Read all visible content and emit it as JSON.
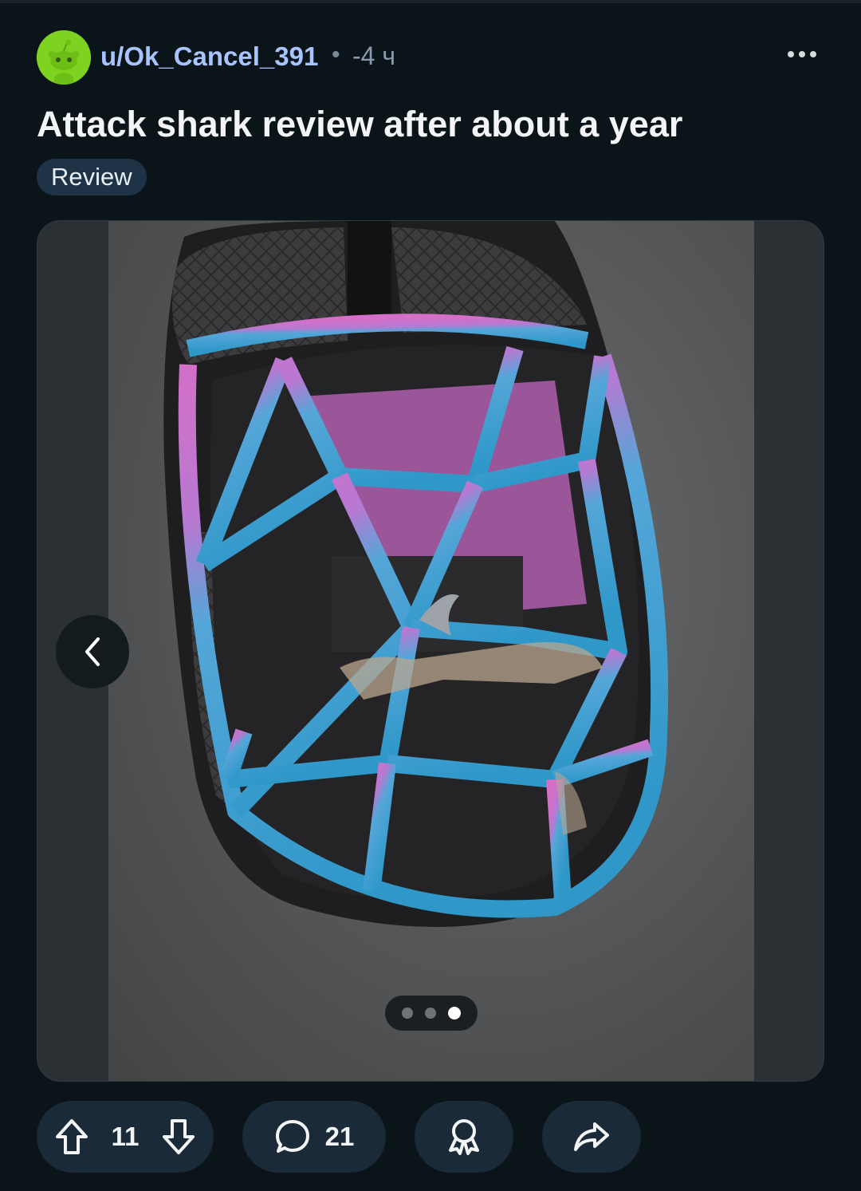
{
  "post": {
    "author": "u/Ok_Cancel_391",
    "separator": "•",
    "time_ago": "-4 ч",
    "title": "Attack shark review after about a year",
    "flair": "Review"
  },
  "media": {
    "image_subject": "blue-pink perforated honeycomb gaming mouse shell",
    "current_image": 3,
    "total_images": 3
  },
  "actions": {
    "upvotes": "11",
    "comments": "21"
  },
  "icons": {
    "more": "more-horizontal-icon",
    "prev": "chevron-left-icon",
    "upvote": "arrow-up-icon",
    "downvote": "arrow-down-icon",
    "comment": "comment-bubble-icon",
    "award": "award-icon",
    "share": "share-arrow-icon"
  },
  "colors": {
    "background": "#0b1418",
    "username": "#a8c4ff",
    "pill": "#1a2a38",
    "flair": "#1f3346",
    "avatar": "#7ed321"
  }
}
